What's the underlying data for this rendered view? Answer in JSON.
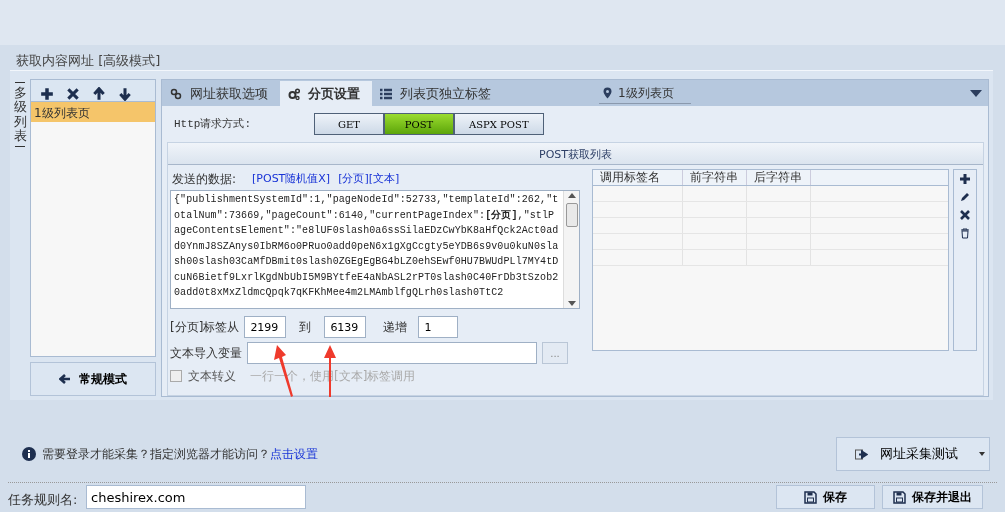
{
  "section_title": "获取内容网址 [高级模式]",
  "side_label": "多级列表",
  "level_tools": [
    {
      "kind": "add"
    },
    {
      "kind": "delete"
    },
    {
      "kind": "up"
    },
    {
      "kind": "down"
    }
  ],
  "level_items": [
    {
      "label": "1级列表页",
      "selected": true
    }
  ],
  "mode_button": "常规模式",
  "tabs": [
    {
      "label": "网址获取选项",
      "selected": false
    },
    {
      "label": "分页设置",
      "selected": true
    },
    {
      "label": "列表页独立标签",
      "selected": false
    }
  ],
  "level_dropdown": {
    "value": "1级列表页"
  },
  "http_method": {
    "label": "Http请求方式:",
    "options": [
      {
        "label": "GET",
        "selected": false
      },
      {
        "label": "POST",
        "selected": true
      },
      {
        "label": "ASPX POST",
        "selected": false
      }
    ]
  },
  "group_title": "POST获取列表",
  "post_data": {
    "label": "发送的数据:",
    "links": [
      "[POST随机值X]",
      "[分页]",
      "[文本]"
    ],
    "value": "{\"publishmentSystemId\":1,\"pageNodeId\":52733,\"templateId\":262,\"totalNum\":73669,\"pageCount\":6140,\"currentPageIndex\":**[分页]**,\"stlPageContentsElement\":\"e8lUF0slash0a6ssSilaEDzCwYbK8aHfQck2Act0add0YnmJ8SZAnys0IbRM6o0PRuo0add0peN6x1gXgCcgty5eYDB6s9v0u0kuN0slash00slash03CaMfDBmit0slash0ZGEgEgBG4bLZ0ehSEwf0HU7BWUdPLl7MY4tDcuN6Bietf9LxrlKgdNbUbI5M9BYtfeE4aNbASL2rPT0slash0C40FrDb3tSzob20add0t8xMxZldmcQpqk7qKFKhMee4m2LMAmblfgQLrh0slash0TtC2"
  },
  "pagination": {
    "from_label": "[分页]标签从",
    "from": "2199",
    "to_label": "到",
    "to": "6139",
    "step_label": "递增",
    "step": "1"
  },
  "text_import": {
    "label": "文本导入变量",
    "browse": "..."
  },
  "text_escape": {
    "label": "文本转义",
    "checked": false,
    "disabled": true,
    "hint": "一行一个，使用[文本]标签调用"
  },
  "tag_table": {
    "columns": [
      "调用标签名",
      "前字符串",
      "后字符串"
    ]
  },
  "table_tools": [
    {
      "kind": "add"
    },
    {
      "kind": "edit"
    },
    {
      "kind": "delete"
    },
    {
      "kind": "trash"
    }
  ],
  "login_hint": {
    "text": "需要登录才能采集？指定浏览器才能访问？",
    "link": "点击设置"
  },
  "test_button": "网址采集测试",
  "rule_name": {
    "label": "任务规则名:",
    "value": "cheshirex.com"
  },
  "footer_buttons": [
    {
      "label": "保存"
    },
    {
      "label": "保存并退出"
    }
  ],
  "annotations": [
    {
      "kind": "arrow"
    },
    {
      "kind": "arrow"
    }
  ]
}
